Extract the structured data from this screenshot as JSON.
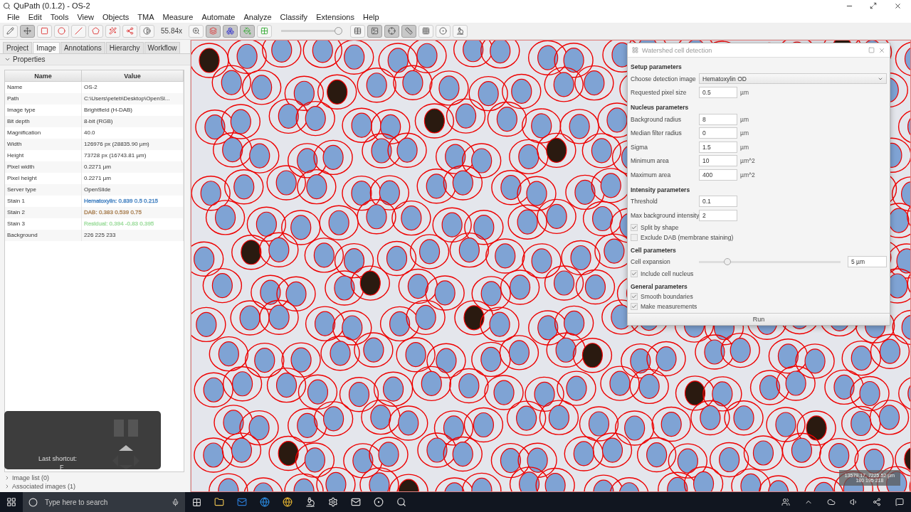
{
  "window": {
    "title": "QuPath (0.1.2) - OS-2"
  },
  "menu": [
    "File",
    "Edit",
    "Tools",
    "View",
    "Objects",
    "TMA",
    "Measure",
    "Automate",
    "Analyze",
    "Classify",
    "Extensions",
    "Help"
  ],
  "toolbar": {
    "tools": [
      {
        "kind": "brush",
        "selected": false
      },
      {
        "kind": "move",
        "selected": true
      },
      {
        "kind": "rectangle",
        "selected": false
      },
      {
        "kind": "ellipse",
        "selected": false
      },
      {
        "kind": "line",
        "selected": false
      },
      {
        "kind": "polygon",
        "selected": false
      },
      {
        "kind": "wand",
        "selected": false
      },
      {
        "kind": "points",
        "selected": false
      },
      {
        "kind": "contrast",
        "selected": false
      }
    ],
    "zoom": "55.84x",
    "overlays": [
      {
        "kind": "search",
        "selected": false
      },
      {
        "kind": "annotations",
        "selected": true
      },
      {
        "kind": "detections",
        "selected": true
      },
      {
        "kind": "fill",
        "selected": true
      },
      {
        "kind": "tma",
        "selected": false
      }
    ],
    "opacity": {
      "level": 0.95
    },
    "views": [
      {
        "kind": "table",
        "selected": false
      },
      {
        "kind": "overview",
        "selected": true
      },
      {
        "kind": "coords",
        "selected": true
      },
      {
        "kind": "scalebar",
        "selected": true
      },
      {
        "kind": "grid",
        "selected": false
      },
      {
        "kind": "record",
        "selected": false
      },
      {
        "kind": "microscope",
        "selected": false
      }
    ]
  },
  "tabs": [
    {
      "label": "Project",
      "selected": false
    },
    {
      "label": "Image",
      "selected": true
    },
    {
      "label": "Annotations",
      "selected": false
    },
    {
      "label": "Hierarchy",
      "selected": false
    },
    {
      "label": "Workflow",
      "selected": false
    }
  ],
  "properties": {
    "title": "Properties",
    "expanded": true,
    "columns": [
      "Name",
      "Value"
    ],
    "rows": [
      {
        "name": "Name",
        "value": "OS-2"
      },
      {
        "name": "Path",
        "value": "C:\\Users\\peteb\\Desktop\\OpenSl..."
      },
      {
        "name": "Image type",
        "value": "Brightfield (H-DAB)"
      },
      {
        "name": "Bit depth",
        "value": "8-bit (RGB)"
      },
      {
        "name": "Magnification",
        "value": "40.0"
      },
      {
        "name": "Width",
        "value": "126976 px (28835.90 µm)"
      },
      {
        "name": "Height",
        "value": "73728 px (16743.81 µm)"
      },
      {
        "name": "Pixel width",
        "value": "0.2271 µm"
      },
      {
        "name": "Pixel height",
        "value": "0.2271 µm"
      },
      {
        "name": "Server type",
        "value": "OpenSlide"
      },
      {
        "name": "Stain 1",
        "value": "Hematoxylin: 0.839 0.5 0.215",
        "color": "#4a86c4"
      },
      {
        "name": "Stain 2",
        "value": "DAB: 0.383 0.539 0.75",
        "color": "#b08a60"
      },
      {
        "name": "Stain 3",
        "value": "Residual: 0.394 -0.83 0.395",
        "color": "#a8e0a8"
      },
      {
        "name": "Background",
        "value": "226 225 233"
      }
    ]
  },
  "image_list": [
    {
      "label": "Image list (0)",
      "expanded": false
    },
    {
      "label": "Associated images (1)",
      "expanded": false
    }
  ],
  "shortcut_overlay": {
    "label": "Last shortcut:",
    "key": "F"
  },
  "viewer": {
    "cursor_info": [
      "13579.17, 7225.52 µm",
      "180 195 218"
    ]
  },
  "dialog": {
    "title": "Watershed cell detection",
    "sections": [
      {
        "title": "Setup parameters",
        "items": [
          {
            "kind": "dropdown",
            "label": "Choose detection image",
            "value": "Hematoxylin OD"
          },
          {
            "kind": "field",
            "label": "Requested pixel size",
            "value": "0.5",
            "unit": "µm"
          }
        ]
      },
      {
        "title": "Nucleus parameters",
        "items": [
          {
            "kind": "field",
            "label": "Background radius",
            "value": "8",
            "unit": "µm"
          },
          {
            "kind": "field",
            "label": "Median filter radius",
            "value": "0",
            "unit": "µm"
          },
          {
            "kind": "field",
            "label": "Sigma",
            "value": "1.5",
            "unit": "µm"
          },
          {
            "kind": "field",
            "label": "Minimum area",
            "value": "10",
            "unit": "µm^2"
          },
          {
            "kind": "field",
            "label": "Maximum area",
            "value": "400",
            "unit": "µm^2"
          }
        ]
      },
      {
        "title": "Intensity parameters",
        "items": [
          {
            "kind": "field",
            "label": "Threshold",
            "value": "0.1"
          },
          {
            "kind": "field",
            "label": "Max background intensity",
            "value": "2"
          },
          {
            "kind": "checkbox",
            "label": "Split by shape",
            "checked": true
          },
          {
            "kind": "checkbox",
            "label": "Exclude DAB (membrane staining)",
            "checked": false
          }
        ]
      },
      {
        "title": "Cell parameters",
        "items": [
          {
            "kind": "slider",
            "label": "Cell expansion",
            "level": 0.2,
            "value": "5 µm"
          },
          {
            "kind": "checkbox",
            "label": "Include cell nucleus",
            "checked": true
          }
        ]
      },
      {
        "title": "General parameters",
        "items": [
          {
            "kind": "checkbox",
            "label": "Smooth boundaries",
            "checked": true
          },
          {
            "kind": "checkbox",
            "label": "Make measurements",
            "checked": true
          }
        ]
      }
    ],
    "button": "Run"
  },
  "taskbar": {
    "search_placeholder": "Type here to search"
  }
}
